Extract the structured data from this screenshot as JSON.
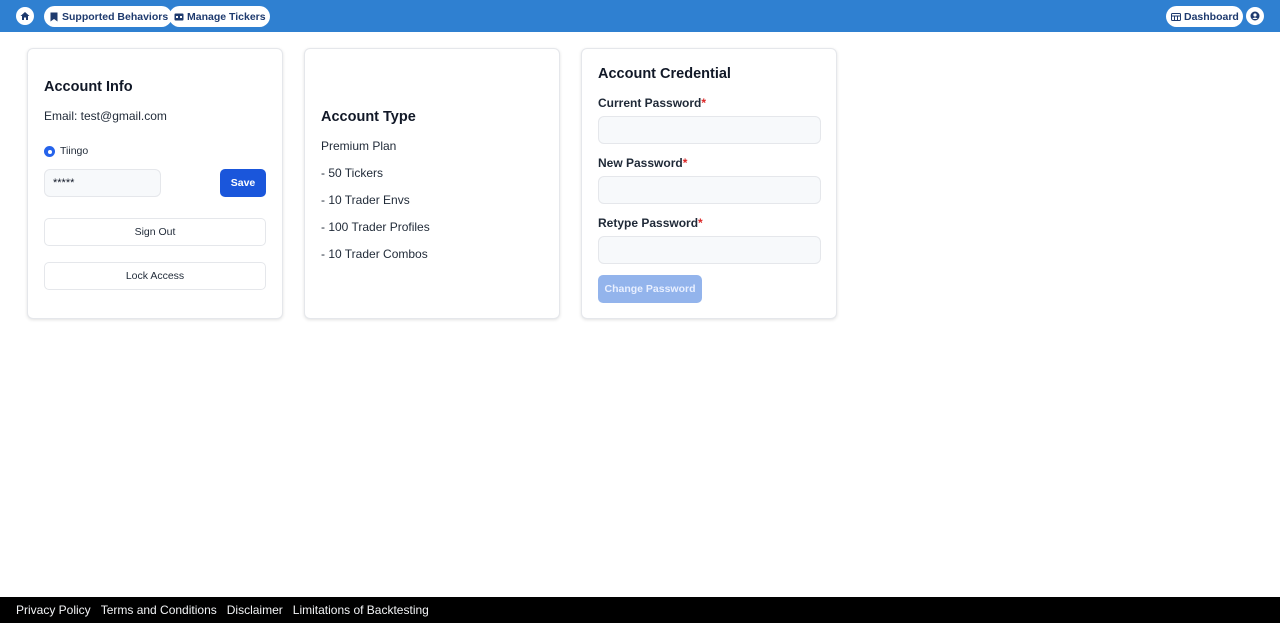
{
  "nav": {
    "home_icon": "home-icon",
    "supported_behaviors": {
      "label": "Supported Behaviors",
      "icon": "bookmark-icon"
    },
    "manage_tickers": {
      "label": "Manage Tickers",
      "icon": "ticket-icon"
    },
    "dashboard": {
      "label": "Dashboard",
      "icon": "table-icon"
    },
    "account_icon": "user-circle-icon",
    "bar_color": "#2f80d1"
  },
  "account_info": {
    "title": "Account Info",
    "email": "Email: test@gmail.com",
    "provider_label": "Tiingo",
    "api_key_value": "*****",
    "save_label": "Save",
    "sign_out_label": "Sign Out",
    "lock_access_label": "Lock Access"
  },
  "account_type": {
    "title": "Account Type",
    "plan": "Premium Plan",
    "features": [
      "- 50 Tickers",
      "- 10 Trader Envs",
      "- 100 Trader Profiles",
      "- 10 Trader Combos"
    ]
  },
  "account_credential": {
    "title": "Account Credential",
    "required_marker": "*",
    "current_password_label": "Current Password",
    "current_password_value": "",
    "new_password_label": "New Password",
    "new_password_value": "",
    "retype_password_label": "Retype Password",
    "retype_password_value": "",
    "change_password_label": "Change Password"
  },
  "footer": {
    "links": [
      "Privacy Policy",
      "Terms and Conditions",
      "Disclaimer",
      "Limitations of Backtesting"
    ]
  }
}
